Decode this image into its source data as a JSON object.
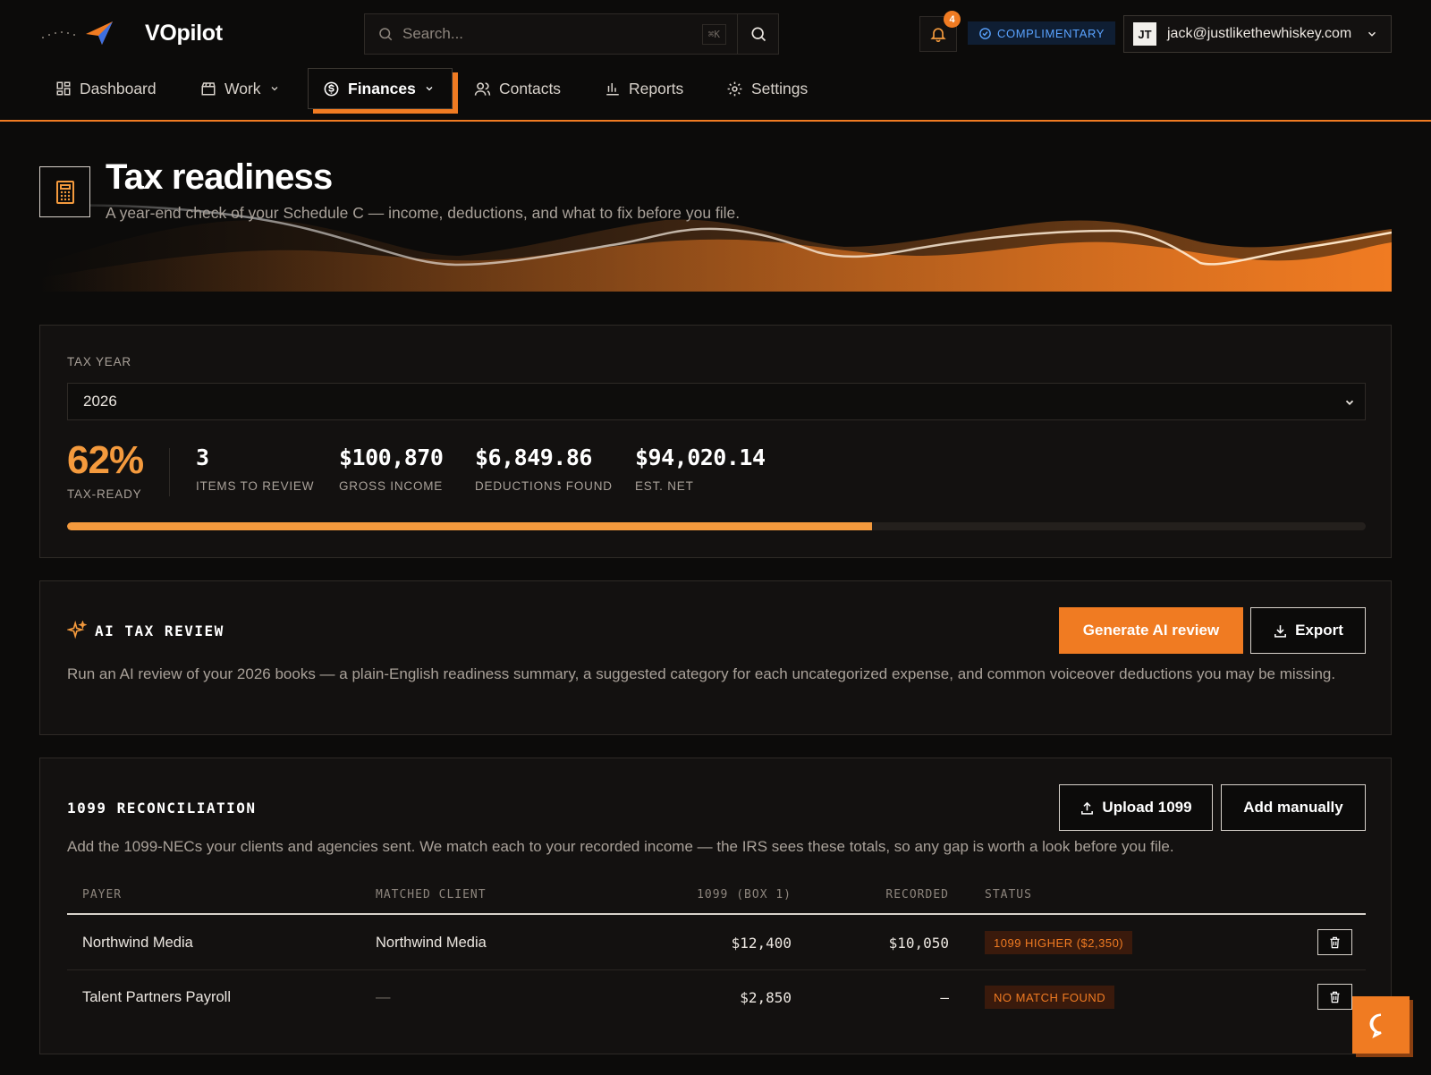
{
  "app": {
    "name": "VOpilot",
    "search_placeholder": "Search...",
    "search_shortcut": "⌘K",
    "notifications_count": "4",
    "plan_badge": "COMPLIMENTARY",
    "user_initials": "JT",
    "user_email": "jack@justlikethewhiskey.com"
  },
  "nav": {
    "items": [
      {
        "label": "Dashboard",
        "icon": "dashboard-icon"
      },
      {
        "label": "Work",
        "icon": "clapperboard-icon"
      },
      {
        "label": "Finances",
        "icon": "dollar-circle-icon",
        "active": true
      },
      {
        "label": "Contacts",
        "icon": "users-icon"
      },
      {
        "label": "Reports",
        "icon": "bar-chart-icon"
      },
      {
        "label": "Settings",
        "icon": "gear-icon"
      }
    ]
  },
  "hero": {
    "title": "Tax readiness",
    "subtitle": "A year-end check of your Schedule C — income, deductions, and what to fix before you file."
  },
  "summary": {
    "tax_year_label": "TAX YEAR",
    "tax_year": "2026",
    "ready_pct": "62%",
    "ready_label": "TAX-READY",
    "progress_fraction": 0.62,
    "stats": [
      {
        "value": "3",
        "label": "ITEMS TO REVIEW"
      },
      {
        "value": "$100,870",
        "label": "GROSS INCOME"
      },
      {
        "value": "$6,849.86",
        "label": "DEDUCTIONS FOUND"
      },
      {
        "value": "$94,020.14",
        "label": "EST. NET"
      }
    ]
  },
  "ai_review": {
    "title": "AI TAX REVIEW",
    "generate_label": "Generate AI review",
    "export_label": "Export",
    "description": "Run an AI review of your 2026 books — a plain-English readiness summary, a suggested category for each uncategorized expense, and common voiceover deductions you may be missing."
  },
  "reconciliation": {
    "title": "1099 RECONCILIATION",
    "upload_label": "Upload 1099",
    "add_label": "Add manually",
    "description": "Add the 1099-NECs your clients and agencies sent. We match each to your recorded income — the IRS sees these totals, so any gap is worth a look before you file.",
    "columns": [
      "PAYER",
      "MATCHED CLIENT",
      "1099 (BOX 1)",
      "RECORDED",
      "STATUS"
    ],
    "rows": [
      {
        "payer": "Northwind Media",
        "client": "Northwind Media",
        "box1": "$12,400",
        "recorded": "$10,050",
        "status": "1099 HIGHER ($2,350)"
      },
      {
        "payer": "Talent Partners Payroll",
        "client": "—",
        "box1": "$2,850",
        "recorded": "—",
        "status": "NO MATCH FOUND"
      }
    ]
  },
  "colors": {
    "accent": "#f07b22",
    "accent_light": "#f49a3d",
    "background": "#0c0b0a",
    "card": "#131110",
    "plan_badge_text": "#5aa3ff"
  }
}
